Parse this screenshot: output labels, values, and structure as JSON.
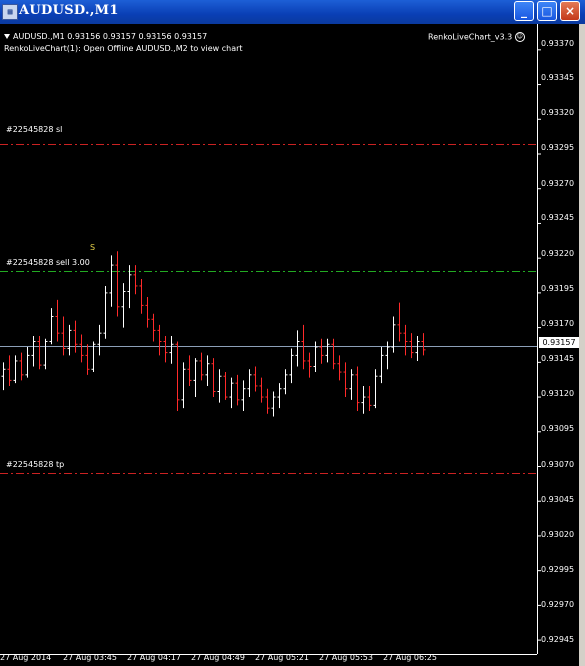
{
  "window": {
    "title": "AUDUSD.,M1",
    "minimize": "_",
    "maximize": "□",
    "close": "×"
  },
  "chart_info": {
    "symbol_line": "AUDUSD.,M1  0.93156 0.93157 0.93156 0.93157",
    "indicator_line": "RenkoLiveChart(1): Open Offline AUDUSD.,M2 to view chart",
    "ea_label": "RenkoLiveChart_v3.3",
    "ea_icon": "smiley-icon",
    "trade_signal": "S"
  },
  "order_lines": [
    {
      "label": "#22545828 sl",
      "price": 0.93302,
      "color": "#cc2222"
    },
    {
      "label": "#22545828 sell 3.00",
      "price": 0.93211,
      "color": "#22aa22"
    },
    {
      "label": "#22545828 tp",
      "price": 0.93065,
      "color": "#cc2222"
    }
  ],
  "current_price": "0.93157",
  "price_axis": [
    "0.93370",
    "0.93345",
    "0.93320",
    "0.93295",
    "0.93270",
    "0.93245",
    "0.93220",
    "0.93195",
    "0.93170",
    "0.93145",
    "0.93120",
    "0.93095",
    "0.93070",
    "0.93045",
    "0.93020",
    "0.92995",
    "0.92970",
    "0.92945"
  ],
  "time_axis": [
    "27 Aug 2014",
    "27 Aug 03:45",
    "27 Aug 04:17",
    "27 Aug 04:49",
    "27 Aug 05:21",
    "27 Aug 05:53",
    "27 Aug 06:25"
  ],
  "colors": {
    "bull_bar": "#ffffff",
    "bear_bar": "#ff2a2a",
    "bid_line": "#8c9fb8"
  },
  "chart_data": {
    "type": "bar",
    "ylim": [
      0.92935,
      0.93385
    ],
    "bars": [
      [
        0.93135,
        0.93145,
        0.93125,
        0.9314
      ],
      [
        0.9314,
        0.9315,
        0.93128,
        0.93132
      ],
      [
        0.93132,
        0.9315,
        0.9313,
        0.93146
      ],
      [
        0.93146,
        0.93152,
        0.93132,
        0.93136
      ],
      [
        0.93136,
        0.93156,
        0.93134,
        0.9315
      ],
      [
        0.9315,
        0.93164,
        0.93142,
        0.9316
      ],
      [
        0.9316,
        0.93164,
        0.9314,
        0.93143
      ],
      [
        0.93143,
        0.93162,
        0.9314,
        0.9316
      ],
      [
        0.9316,
        0.93184,
        0.93158,
        0.93178
      ],
      [
        0.93178,
        0.9319,
        0.9316,
        0.93166
      ],
      [
        0.93166,
        0.93178,
        0.9315,
        0.93155
      ],
      [
        0.93155,
        0.93172,
        0.9315,
        0.93168
      ],
      [
        0.93168,
        0.93175,
        0.93152,
        0.93158
      ],
      [
        0.93158,
        0.93165,
        0.93145,
        0.9315
      ],
      [
        0.9315,
        0.93158,
        0.93136,
        0.9314
      ],
      [
        0.9314,
        0.9316,
        0.93138,
        0.93158
      ],
      [
        0.93158,
        0.93172,
        0.9315,
        0.93166
      ],
      [
        0.93166,
        0.932,
        0.93162,
        0.93195
      ],
      [
        0.93195,
        0.93222,
        0.93185,
        0.93215
      ],
      [
        0.93215,
        0.93225,
        0.93178,
        0.93185
      ],
      [
        0.93185,
        0.93202,
        0.9317,
        0.93196
      ],
      [
        0.93196,
        0.93215,
        0.93184,
        0.93208
      ],
      [
        0.93208,
        0.93215,
        0.93194,
        0.932
      ],
      [
        0.932,
        0.93205,
        0.9318,
        0.93186
      ],
      [
        0.93186,
        0.93192,
        0.9317,
        0.93176
      ],
      [
        0.93176,
        0.9318,
        0.9316,
        0.93168
      ],
      [
        0.93168,
        0.93172,
        0.9315,
        0.9316
      ],
      [
        0.9316,
        0.93164,
        0.93145,
        0.93152
      ],
      [
        0.93152,
        0.93164,
        0.93144,
        0.93158
      ],
      [
        0.93158,
        0.9316,
        0.9311,
        0.93118
      ],
      [
        0.93118,
        0.93145,
        0.93112,
        0.9314
      ],
      [
        0.9314,
        0.9315,
        0.93128,
        0.93132
      ],
      [
        0.93132,
        0.93148,
        0.9312,
        0.93146
      ],
      [
        0.93146,
        0.93152,
        0.93132,
        0.93136
      ],
      [
        0.93136,
        0.9315,
        0.93128,
        0.93144
      ],
      [
        0.93144,
        0.93148,
        0.9312,
        0.93124
      ],
      [
        0.93124,
        0.9314,
        0.93116,
        0.93135
      ],
      [
        0.93135,
        0.93138,
        0.93118,
        0.9312
      ],
      [
        0.9312,
        0.93134,
        0.93112,
        0.9313
      ],
      [
        0.9313,
        0.93136,
        0.93114,
        0.93118
      ],
      [
        0.93118,
        0.93132,
        0.9311,
        0.93126
      ],
      [
        0.93126,
        0.9314,
        0.9312,
        0.93136
      ],
      [
        0.93136,
        0.93142,
        0.93124,
        0.93128
      ],
      [
        0.93128,
        0.93134,
        0.93116,
        0.9312
      ],
      [
        0.9312,
        0.93126,
        0.93108,
        0.93112
      ],
      [
        0.93112,
        0.93124,
        0.93106,
        0.9312
      ],
      [
        0.9312,
        0.9313,
        0.93112,
        0.93126
      ],
      [
        0.93126,
        0.9314,
        0.93122,
        0.93136
      ],
      [
        0.93136,
        0.93155,
        0.9313,
        0.9315
      ],
      [
        0.9315,
        0.93168,
        0.93142,
        0.9316
      ],
      [
        0.9316,
        0.93172,
        0.9314,
        0.93146
      ],
      [
        0.93146,
        0.93152,
        0.93134,
        0.93142
      ],
      [
        0.93142,
        0.9316,
        0.93138,
        0.93156
      ],
      [
        0.93156,
        0.93162,
        0.93144,
        0.9315
      ],
      [
        0.9315,
        0.93162,
        0.93145,
        0.93158
      ],
      [
        0.93158,
        0.93162,
        0.9314,
        0.93144
      ],
      [
        0.93144,
        0.9315,
        0.93132,
        0.93138
      ],
      [
        0.93138,
        0.93145,
        0.9312,
        0.93126
      ],
      [
        0.93126,
        0.9314,
        0.93118,
        0.93136
      ],
      [
        0.93136,
        0.93142,
        0.9311,
        0.93116
      ],
      [
        0.93116,
        0.93128,
        0.93108,
        0.9312
      ],
      [
        0.9312,
        0.93128,
        0.9311,
        0.93114
      ],
      [
        0.93114,
        0.9314,
        0.93112,
        0.93135
      ],
      [
        0.93135,
        0.93156,
        0.9313,
        0.9315
      ],
      [
        0.9315,
        0.9316,
        0.9314,
        0.93156
      ],
      [
        0.93156,
        0.93178,
        0.93152,
        0.93172
      ],
      [
        0.93172,
        0.93188,
        0.9316,
        0.93166
      ],
      [
        0.93166,
        0.93172,
        0.9315,
        0.9316
      ],
      [
        0.9316,
        0.93166,
        0.93148,
        0.93152
      ],
      [
        0.93152,
        0.93164,
        0.93146,
        0.9316
      ],
      [
        0.9316,
        0.93166,
        0.9315,
        0.93154
      ]
    ]
  }
}
